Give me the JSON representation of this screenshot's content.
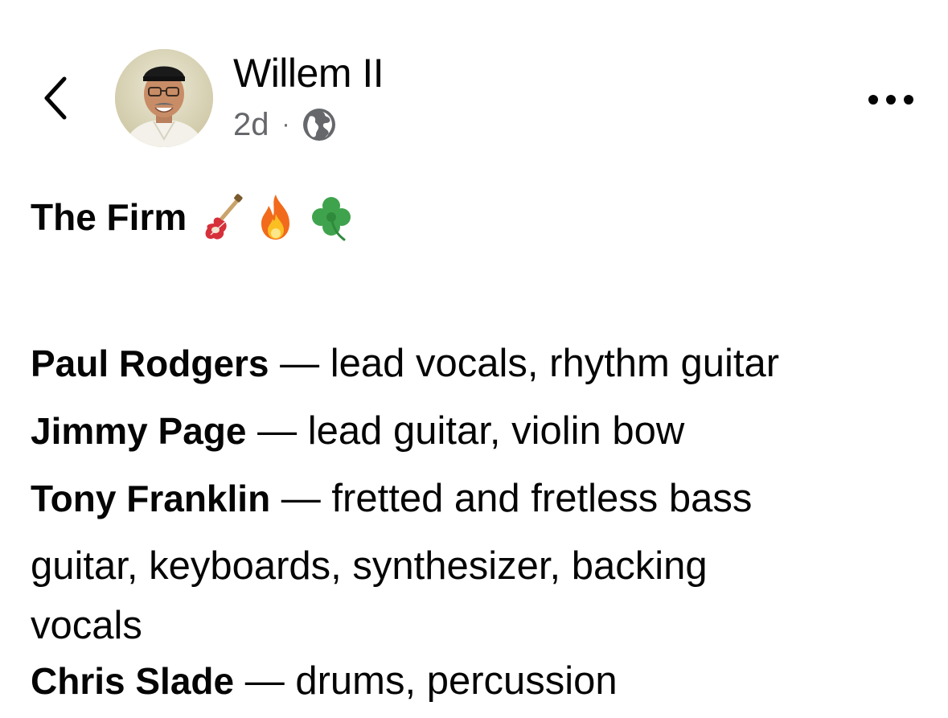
{
  "header": {
    "author": "Willem II",
    "time": "2d",
    "separator": "·",
    "privacy_icon": "globe-icon",
    "more_icon": "more-dots-icon",
    "back_icon": "chevron-left-icon"
  },
  "post": {
    "title": "The Firm",
    "title_emojis": [
      "guitar-emoji",
      "fire-emoji",
      "shamrock-emoji"
    ],
    "members": [
      {
        "name": "Paul Rodgers",
        "dash": " — ",
        "role": "lead vocals, rhythm guitar"
      },
      {
        "name": "Jimmy Page",
        "dash": " — ",
        "role": "lead guitar, violin bow"
      },
      {
        "name": "Tony Franklin",
        "dash": " — ",
        "role": "fretted and fretless bass"
      },
      {
        "name": "Chris Slade",
        "dash": " — ",
        "role": "drums, percussion"
      }
    ],
    "continuation_1": "guitar, keyboards, synthesizer, backing",
    "continuation_2": "vocals"
  },
  "colors": {
    "text": "#050505",
    "secondary": "#65676b"
  }
}
